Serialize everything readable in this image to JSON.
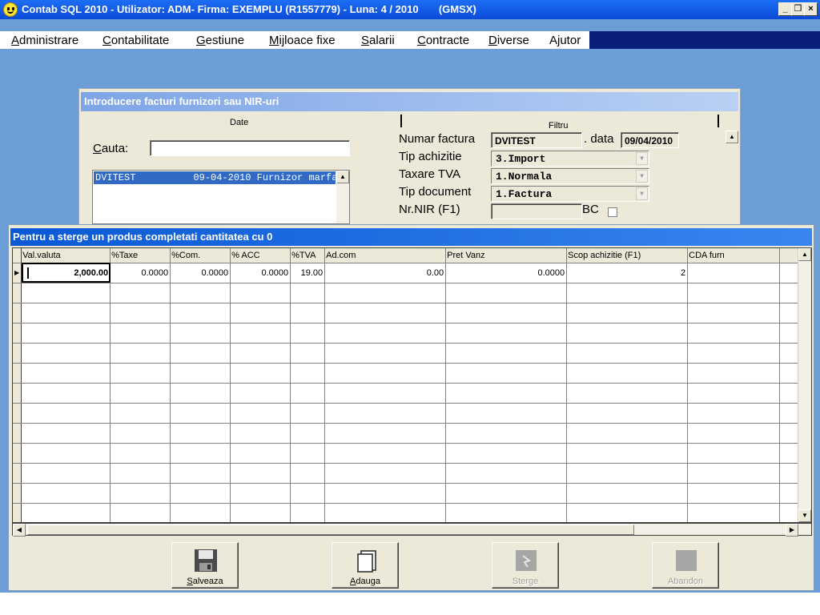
{
  "app": {
    "title": "Contab SQL 2010 - Utilizator: ADM- Firma: EXEMPLU (R1557779) - Luna: 4 / 2010       (GMSX)"
  },
  "menu": {
    "items": [
      {
        "first": "A",
        "rest": "dministrare"
      },
      {
        "first": "C",
        "rest": "ontabilitate"
      },
      {
        "first": "G",
        "rest": "estiune"
      },
      {
        "first": "M",
        "rest": "ijloace fixe"
      },
      {
        "first": "S",
        "rest": "alarii"
      },
      {
        "first": "C",
        "rest": "ontracte"
      },
      {
        "first": "D",
        "rest": "iverse"
      },
      {
        "first": "",
        "rest": "Ajutor"
      }
    ]
  },
  "invoice_window": {
    "title": "Introducere facturi furnizori sau NIR-uri",
    "tab_date": "Date",
    "tab_filter": "Filtru",
    "search_label_first": "C",
    "search_label_rest": "auta:",
    "search_value": "",
    "list_selected": "DVITEST          09-04-2010 Furnizor marfa",
    "invoice_number_label": "Numar factura",
    "invoice_number": "DVITEST",
    "date_label": ". data",
    "date_value": "09/04/2010",
    "purchase_type_label": "Tip achizitie",
    "purchase_type_value": "3.Import",
    "vat_label": "Taxare TVA",
    "vat_value": "1.Normala",
    "doc_type_label": "Tip document",
    "doc_type_value": "1.Factura",
    "nir_label": "Nr.NIR (F1)",
    "nir_value": "",
    "bc_label": "BC"
  },
  "products_window": {
    "title": "Pentru a sterge un produs completati cantitatea cu 0",
    "columns": [
      "Val.valuta",
      "%Taxe",
      "%Com.",
      "% ACC",
      "%TVA",
      "Ad.com",
      "Pret Vanz",
      "Scop achizitie (F1)",
      "CDA furn"
    ],
    "row": [
      "2,000.00",
      "0.0000",
      "0.0000",
      "0.0000",
      "19.00",
      "0.00",
      "0.0000",
      "2",
      ""
    ],
    "empty_rows": 12
  },
  "buttons": {
    "save": "Salveaza",
    "add": "Adauga",
    "delete": "Sterge",
    "abandon": "Abandon"
  }
}
